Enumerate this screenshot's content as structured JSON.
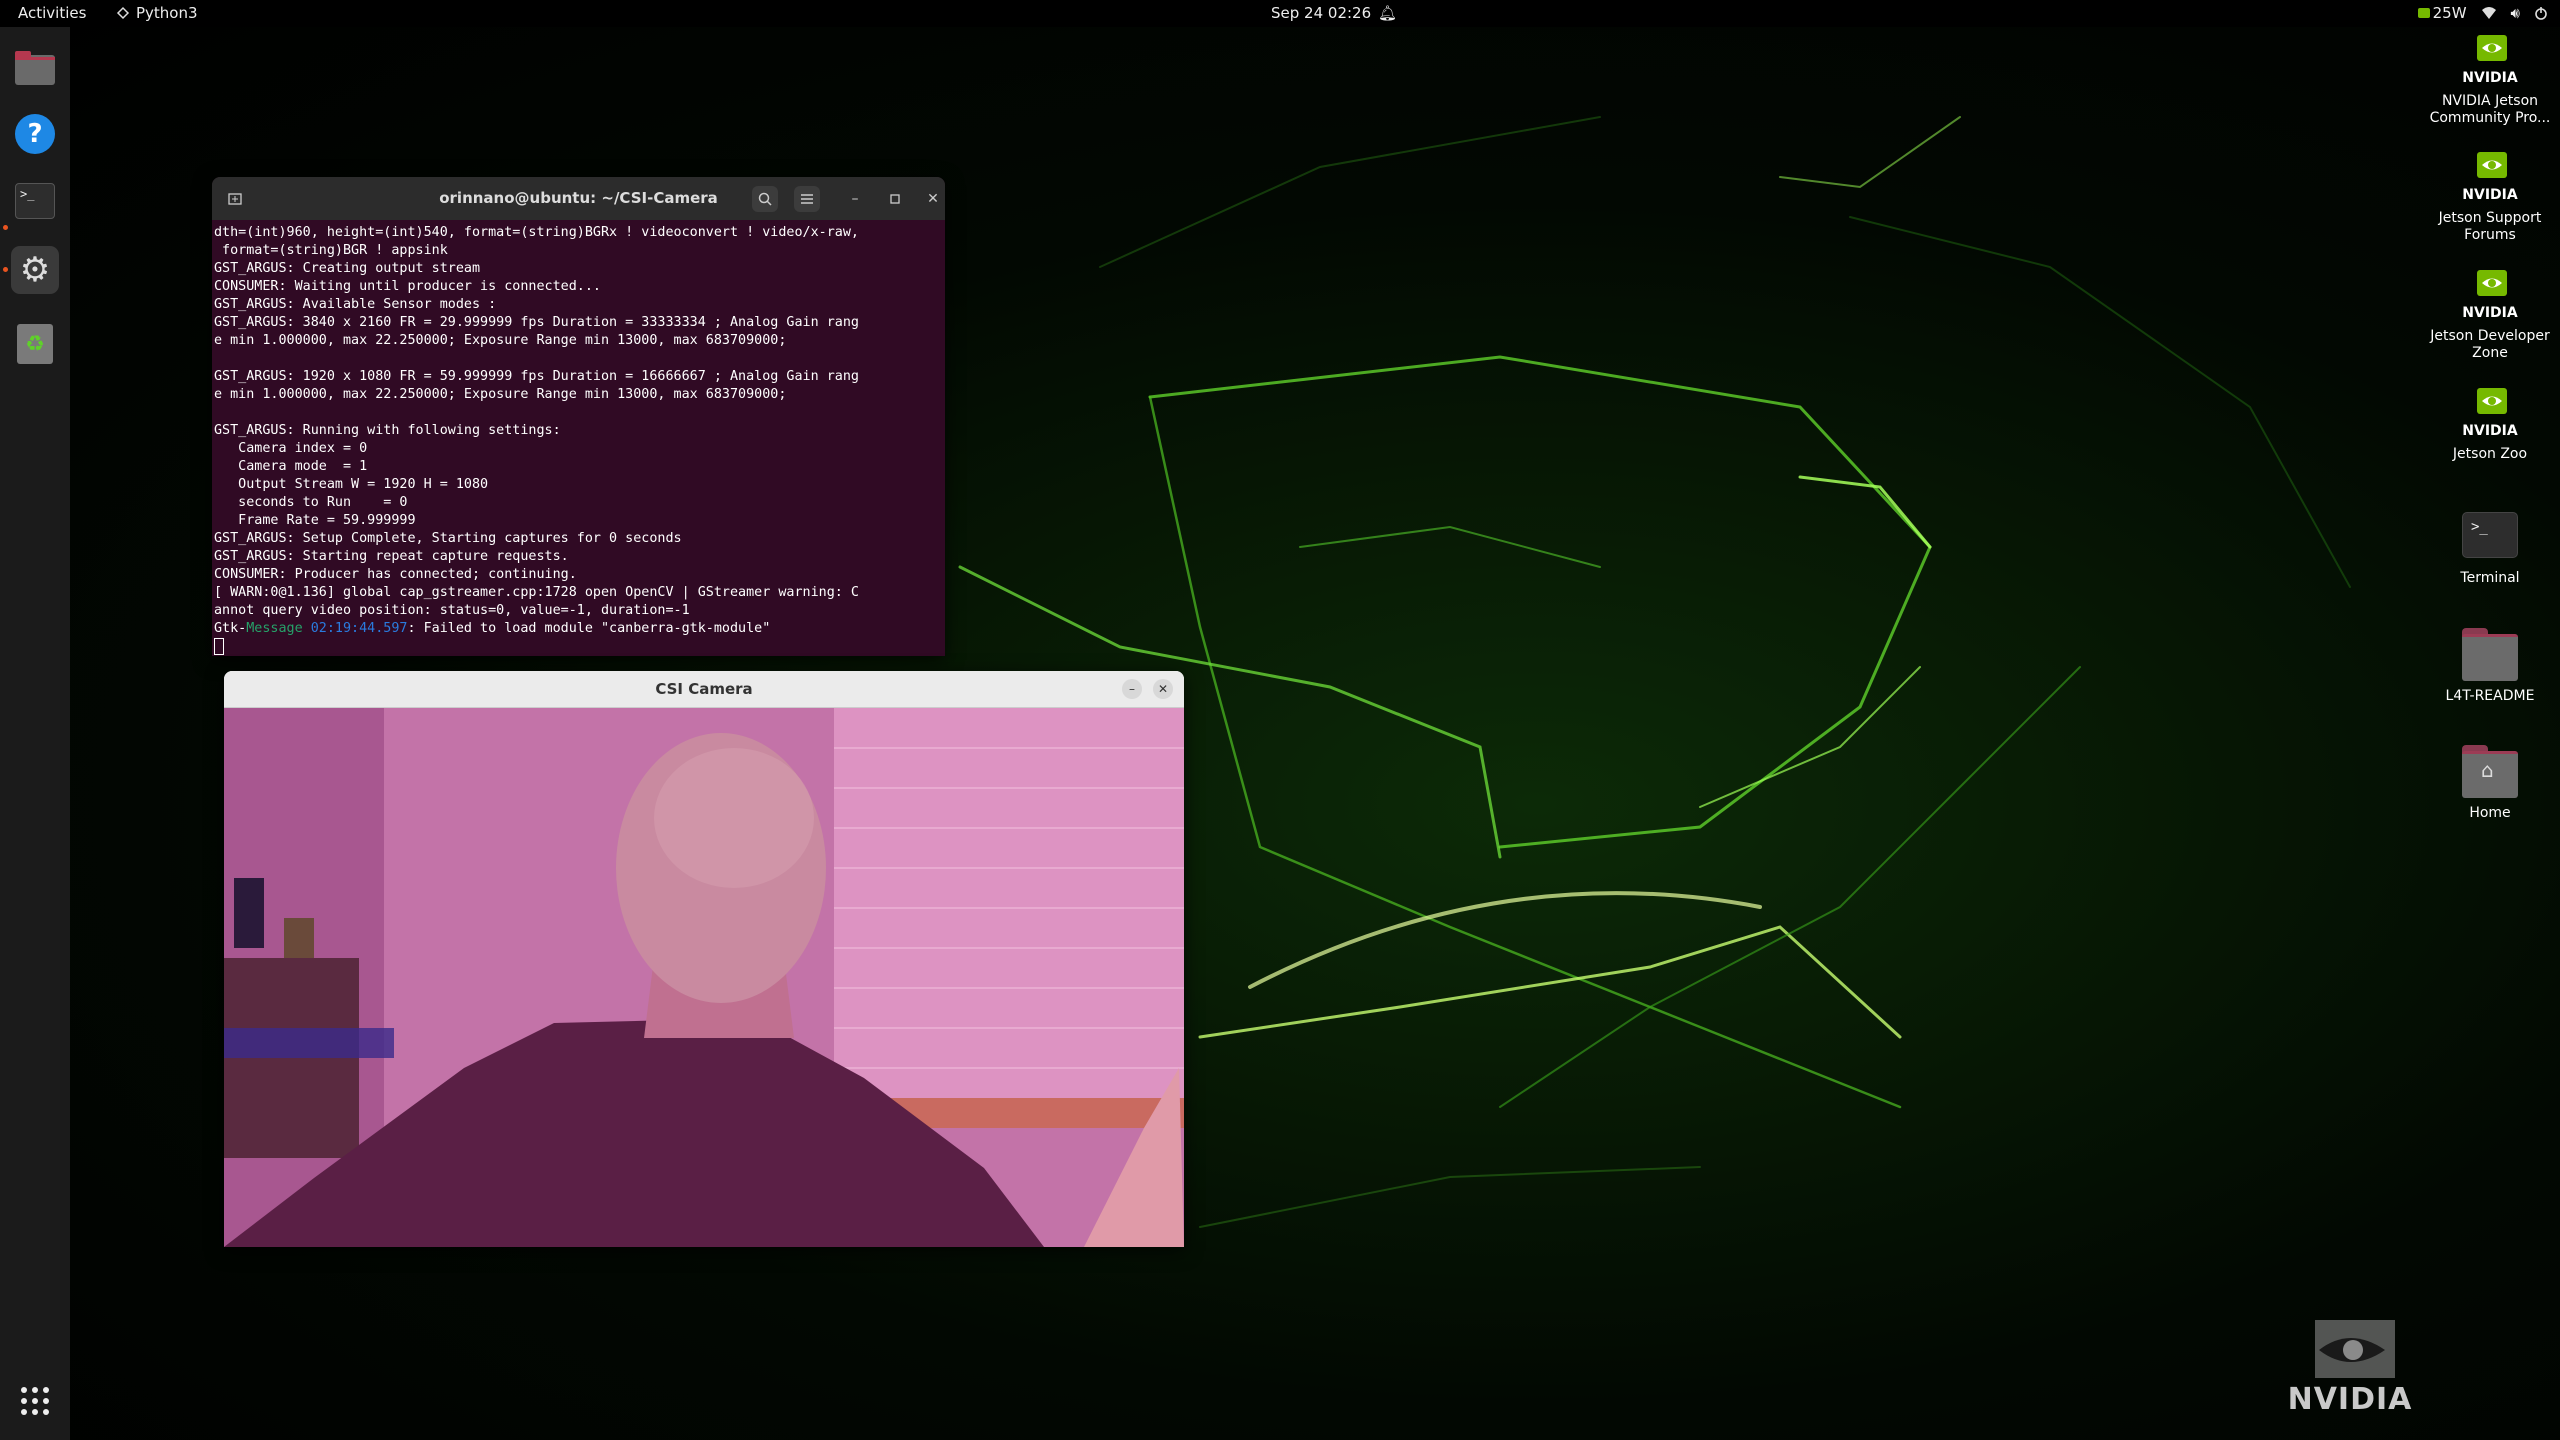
{
  "topbar": {
    "activities": "Activities",
    "app_name": "Python3",
    "clock": "Sep 24 02:26",
    "power_mode": "25W"
  },
  "dock": {
    "items": [
      {
        "name": "files",
        "icon": "folder-icon"
      },
      {
        "name": "help",
        "icon": "help-icon",
        "glyph": "?"
      },
      {
        "name": "terminal",
        "icon": "terminal-icon",
        "glyph": ">_"
      },
      {
        "name": "settings",
        "icon": "gear-icon",
        "glyph": "⚙"
      },
      {
        "name": "trash",
        "icon": "recycle-icon",
        "glyph": "♻"
      }
    ]
  },
  "desktop_icons": {
    "community": "NVIDIA Jetson Community Pro...",
    "support": "Jetson Support Forums",
    "devzone": "Jetson Developer Zone",
    "zoo": "Jetson Zoo",
    "terminal": "Terminal",
    "readme": "L4T-README",
    "home": "Home",
    "nvidia_word": "NVIDIA"
  },
  "corner_logo": "NVIDIA",
  "terminal": {
    "title": "orinnano@ubuntu: ~/CSI-Camera",
    "lines": [
      "dth=(int)960, height=(int)540, format=(string)BGRx ! videoconvert ! video/x-raw,",
      " format=(string)BGR ! appsink",
      "GST_ARGUS: Creating output stream",
      "CONSUMER: Waiting until producer is connected...",
      "GST_ARGUS: Available Sensor modes :",
      "GST_ARGUS: 3840 x 2160 FR = 29.999999 fps Duration = 33333334 ; Analog Gain rang",
      "e min 1.000000, max 22.250000; Exposure Range min 13000, max 683709000;",
      "",
      "GST_ARGUS: 1920 x 1080 FR = 59.999999 fps Duration = 16666667 ; Analog Gain rang",
      "e min 1.000000, max 22.250000; Exposure Range min 13000, max 683709000;",
      "",
      "GST_ARGUS: Running with following settings:",
      "   Camera index = 0",
      "   Camera mode  = 1",
      "   Output Stream W = 1920 H = 1080",
      "   seconds to Run    = 0",
      "   Frame Rate = 59.999999",
      "GST_ARGUS: Setup Complete, Starting captures for 0 seconds",
      "GST_ARGUS: Starting repeat capture requests.",
      "CONSUMER: Producer has connected; continuing.",
      "[ WARN:0@1.136] global cap_gstreamer.cpp:1728 open OpenCV | GStreamer warning: C",
      "annot query video position: status=0, value=-1, duration=-1"
    ],
    "gtk_prefix": "Gtk-",
    "gtk_level": "Message",
    "gtk_time": "02:19:44.597",
    "gtk_text": ": Failed to load module \"canberra-gtk-module\""
  },
  "camera": {
    "title": "CSI Camera"
  },
  "colors": {
    "terminal_bg": "#300a24",
    "accent": "#76b900",
    "ubuntu_orange": "#e95420"
  }
}
